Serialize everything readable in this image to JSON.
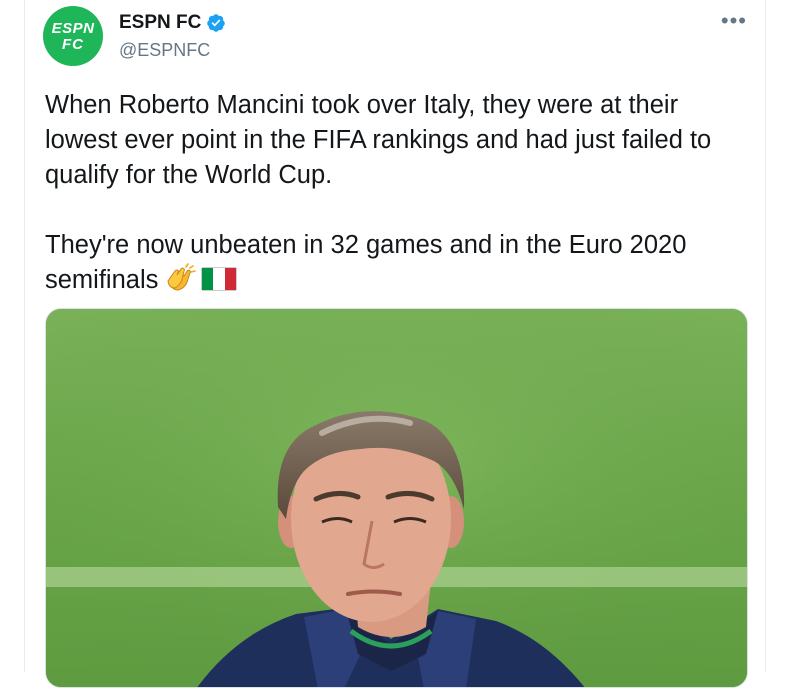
{
  "tweet": {
    "author": {
      "avatar_text_line1": "ESPN",
      "avatar_text_line2": "FC",
      "display_name": "ESPN FC",
      "handle": "@ESPNFC",
      "verified": true,
      "avatar_color": "#1fb65a"
    },
    "more_icon": "more-options-icon",
    "more_label": "•••",
    "text_paragraph1": "When Roberto Mancini took over Italy, they were at their lowest ever point in the FIFA rankings and had just failed to qualify for the World Cup.",
    "text_paragraph2": "They're now unbeaten in 32 games and in the Euro 2020 semifinals",
    "emojis": [
      "clapping-hands-emoji",
      "italy-flag-emoji"
    ],
    "media": {
      "type": "photo",
      "subject": "photo-roberto-mancini-on-pitch"
    },
    "colors": {
      "text": "#14171a",
      "secondary": "#657786",
      "verified": "#1da1f2"
    }
  }
}
